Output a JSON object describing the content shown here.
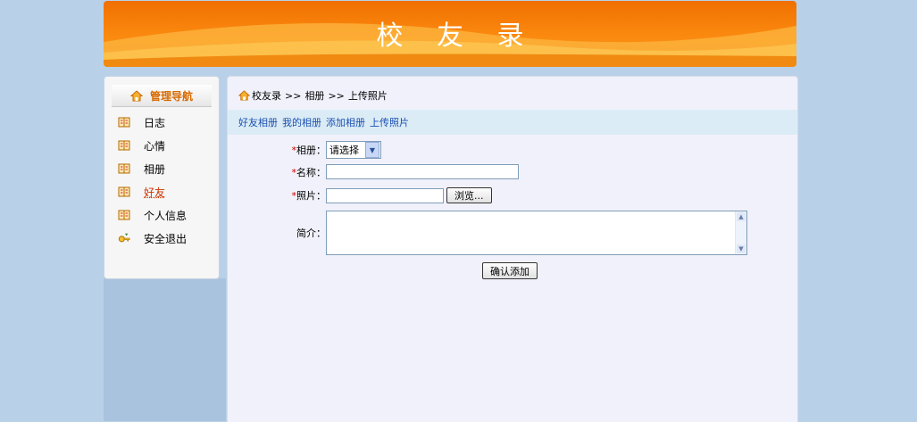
{
  "banner": {
    "title": "校 友 录"
  },
  "sidebar": {
    "title": "管理导航",
    "items": [
      {
        "label": "日志",
        "icon": "journal-icon"
      },
      {
        "label": "心情",
        "icon": "journal-icon"
      },
      {
        "label": "相册",
        "icon": "journal-icon"
      },
      {
        "label": "好友",
        "icon": "journal-icon",
        "active": true
      },
      {
        "label": "个人信息",
        "icon": "journal-icon"
      },
      {
        "label": "安全退出",
        "icon": "logout-key-icon"
      }
    ]
  },
  "breadcrumb": {
    "root": "校友录",
    "sep1": ">>",
    "mid": "相册",
    "sep2": ">>",
    "current": "上传照片"
  },
  "subnav": {
    "links": [
      "好友相册",
      "我的相册",
      "添加相册",
      "上传照片"
    ]
  },
  "form": {
    "album_label": "相册：",
    "album_value": "请选择",
    "name_label": "名称：",
    "photo_label": "照片：",
    "browse_label": "浏览...",
    "intro_label": "简介：",
    "submit_label": "确认添加",
    "required_mark": "*"
  },
  "colors": {
    "banner": "#f57f0a",
    "background": "#b9d1e8",
    "link": "#1a4fb0",
    "required": "#d00000"
  }
}
